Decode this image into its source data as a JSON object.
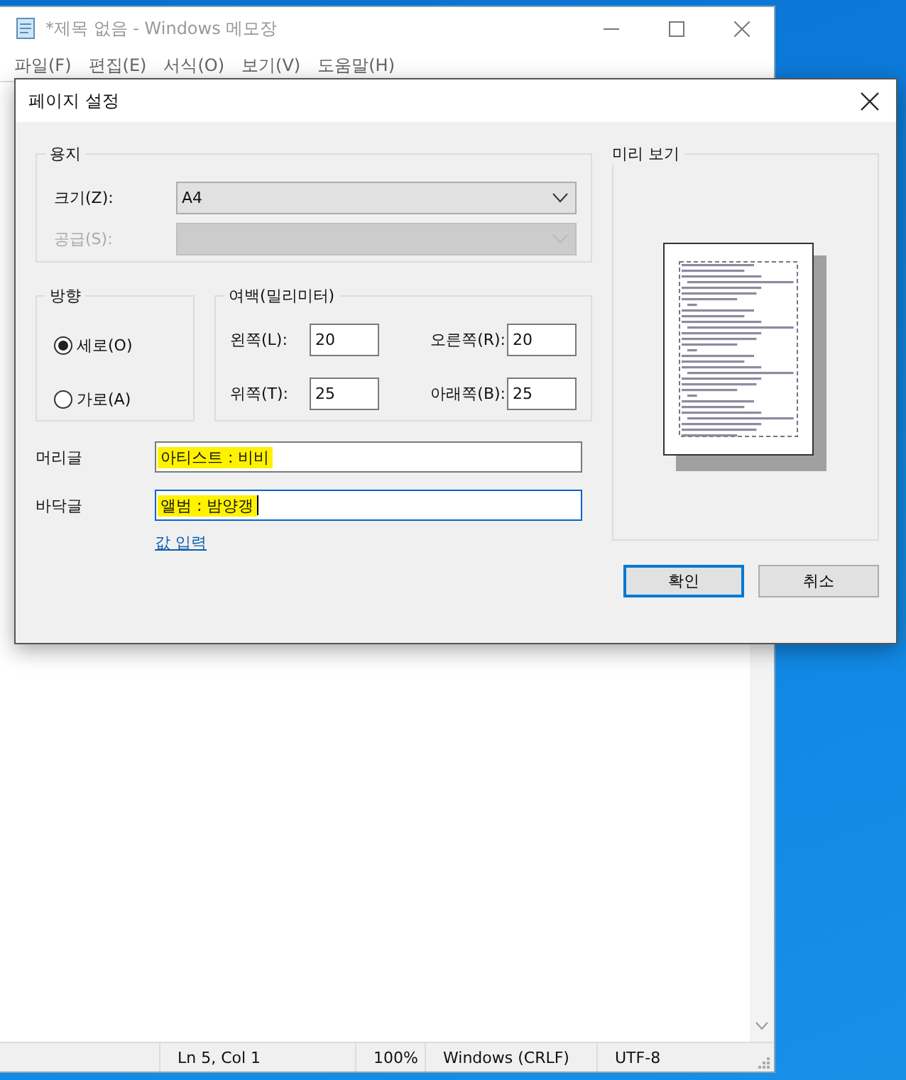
{
  "notepad": {
    "title": "*제목 없음 - Windows 메모장",
    "menu": [
      "파일(F)",
      "편집(E)",
      "서식(O)",
      "보기(V)",
      "도움말(H)"
    ],
    "status_bar": [
      "Ln 5, Col 1",
      "100%",
      "Windows (CRLF)",
      "UTF-8"
    ]
  },
  "dialog": {
    "title": "페이지 설정",
    "paper": {
      "legend": "용지",
      "size_label": "크기(Z):",
      "size_value": "A4",
      "size_disabled": false,
      "source_label": "공급(S):",
      "source_disabled": true
    },
    "orientation": {
      "legend": "방향",
      "options": [
        {
          "label": "세로(O)",
          "selected": true
        },
        {
          "label": "가로(A)",
          "selected": false
        }
      ]
    },
    "margins": {
      "legend": "여백(밀리미터)",
      "fields": [
        {
          "label": "왼쪽(L):",
          "value": "20"
        },
        {
          "label": "오른쪽(R):",
          "value": "20"
        },
        {
          "label": "위쪽(T):",
          "value": "25"
        },
        {
          "label": "아래쪽(B):",
          "value": "25"
        }
      ]
    },
    "header": {
      "label": "머리글",
      "value": "아티스트 : 비비",
      "highlighted": true,
      "focused": false
    },
    "footer": {
      "label": "바닥글",
      "value": "앨범 : 밤양갱",
      "highlighted": true,
      "focused": true
    },
    "link": "값 입력",
    "preview": {
      "legend": "미리 보기"
    },
    "buttons": [
      {
        "label": "확인",
        "default": true
      },
      {
        "label": "취소",
        "default": false
      }
    ]
  }
}
